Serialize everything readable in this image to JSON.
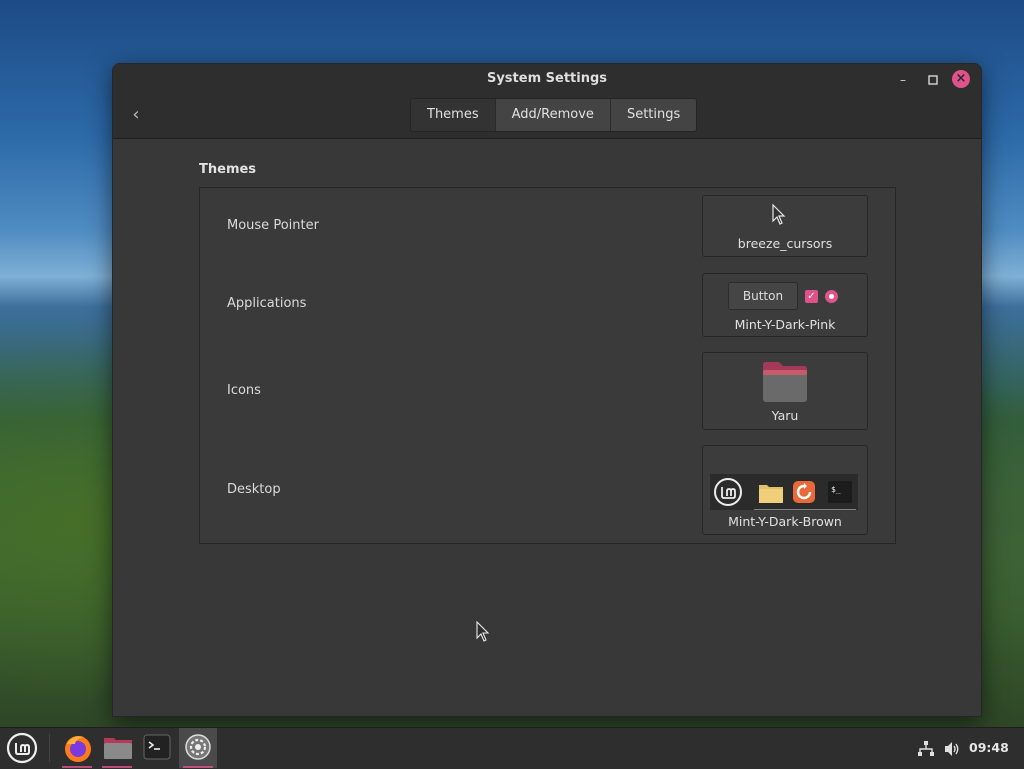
{
  "window": {
    "title": "System Settings",
    "tabs": [
      {
        "label": "Themes",
        "active": true
      },
      {
        "label": "Add/Remove",
        "active": false
      },
      {
        "label": "Settings",
        "active": false
      }
    ]
  },
  "themes": {
    "section_title": "Themes",
    "rows": [
      {
        "label": "Mouse Pointer",
        "value": "breeze_cursors"
      },
      {
        "label": "Applications",
        "value": "Mint-Y-Dark-Pink",
        "preview_button_label": "Button"
      },
      {
        "label": "Icons",
        "value": "Yaru"
      },
      {
        "label": "Desktop",
        "value": "Mint-Y-Dark-Brown",
        "preview_terminal_text": "$_"
      }
    ]
  },
  "taskbar": {
    "apps": [
      "menu-icon",
      "firefox-icon",
      "files-icon",
      "terminal-icon",
      "settings-icon"
    ],
    "clock": "09:48",
    "tray": [
      "network-icon",
      "volume-icon"
    ]
  },
  "colors": {
    "accent": "#e0528a",
    "window_bg": "#383838",
    "titlebar_bg": "#2e2e2e",
    "folder": "#e2c06a",
    "desktop_accent": "#e86a3a"
  }
}
